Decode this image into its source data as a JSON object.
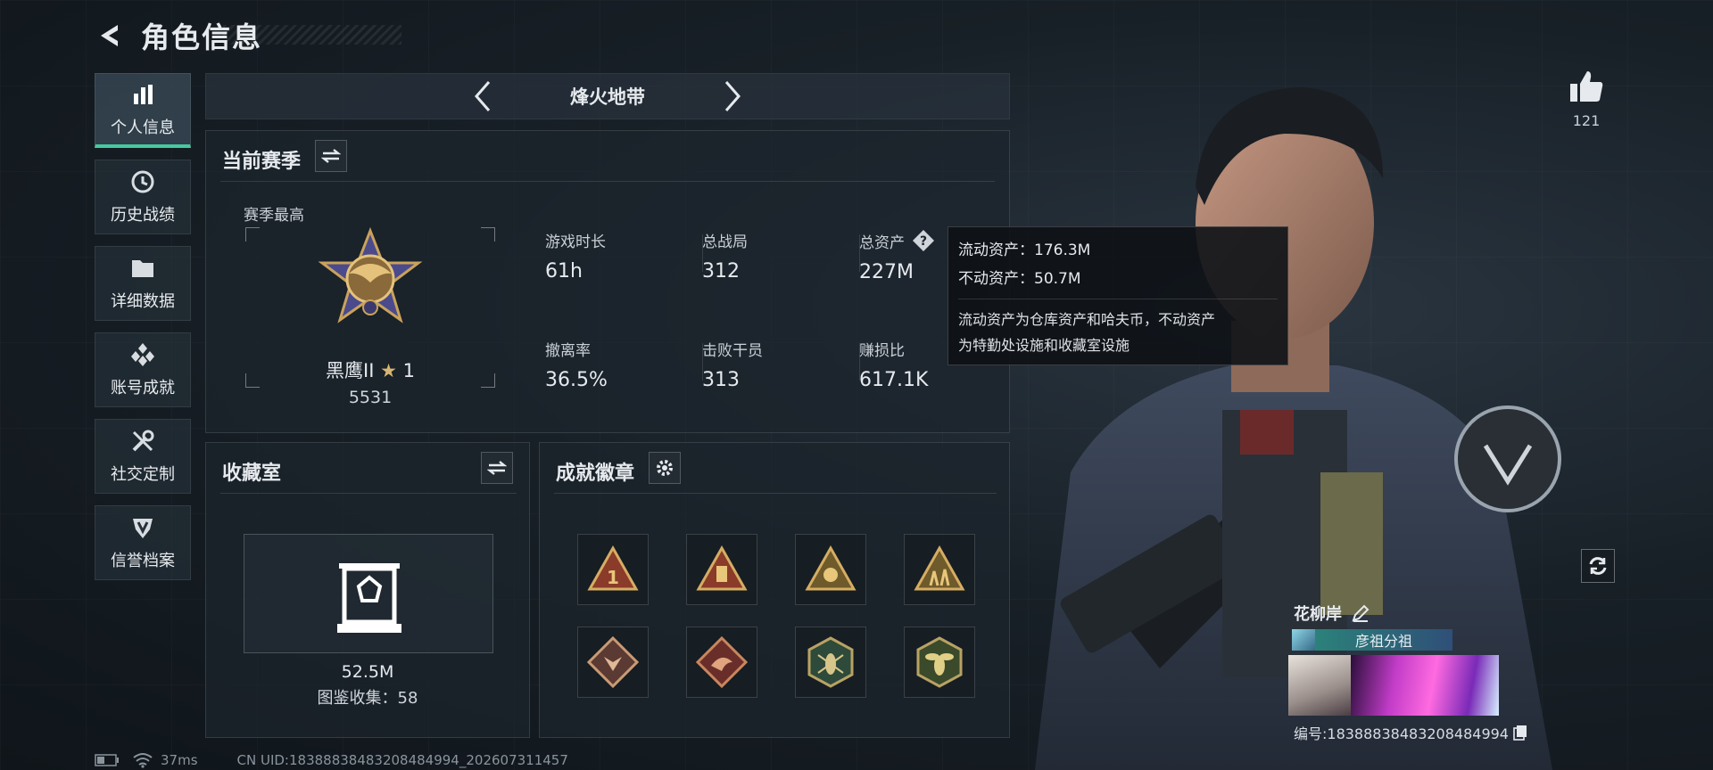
{
  "header": {
    "title": "角色信息"
  },
  "sidebar": {
    "items": [
      {
        "label": "个人信息",
        "icon": "bar-chart-icon"
      },
      {
        "label": "历史战绩",
        "icon": "clock-icon"
      },
      {
        "label": "详细数据",
        "icon": "folder-icon"
      },
      {
        "label": "账号成就",
        "icon": "achievement-icon"
      },
      {
        "label": "社交定制",
        "icon": "tools-icon"
      },
      {
        "label": "信誉档案",
        "icon": "shield-icon"
      }
    ],
    "active_index": 0
  },
  "mode": {
    "name": "烽火地带"
  },
  "season": {
    "title": "当前赛季",
    "best_label": "赛季最高",
    "rank_name": "黑鹰II",
    "rank_stars": "1",
    "rank_score": "5531",
    "stats": [
      {
        "label": "游戏时长",
        "value": "61h"
      },
      {
        "label": "总战局",
        "value": "312"
      },
      {
        "label": "总资产",
        "value": "227M"
      },
      {
        "label": "撤离率",
        "value": "36.5%"
      },
      {
        "label": "击败干员",
        "value": "313"
      },
      {
        "label": "赚损比",
        "value": "617.1K"
      }
    ]
  },
  "tooltip": {
    "liquid": "流动资产：176.3M",
    "fixed": "不动资产：50.7M",
    "desc_line1": "流动资产为仓库资产和哈夫币，不动资产",
    "desc_line2": "为特勤处设施和收藏室设施"
  },
  "collection": {
    "title": "收藏室",
    "value": "52.5M",
    "catalog": "图鉴收集：58"
  },
  "badges": {
    "title": "成就徽章",
    "items": [
      "triangle-1-badge",
      "triangle-canister-badge",
      "triangle-skull-badge",
      "triangle-figures-badge",
      "diamond-wolf-badge",
      "diamond-dragon-badge",
      "hexagon-hornet-badge",
      "hexagon-wasp-badge"
    ]
  },
  "player": {
    "likes": "121",
    "name": "花柳岸",
    "group": "彦祖分祖",
    "id_text": "编号:18388838483208484994"
  },
  "footer": {
    "ping": "37ms",
    "uid": "CN UID:18388838483208484994_202607311457"
  },
  "colors": {
    "accent": "#47c9a0",
    "gold": "#c9a25c",
    "panel": "#1c242c"
  }
}
